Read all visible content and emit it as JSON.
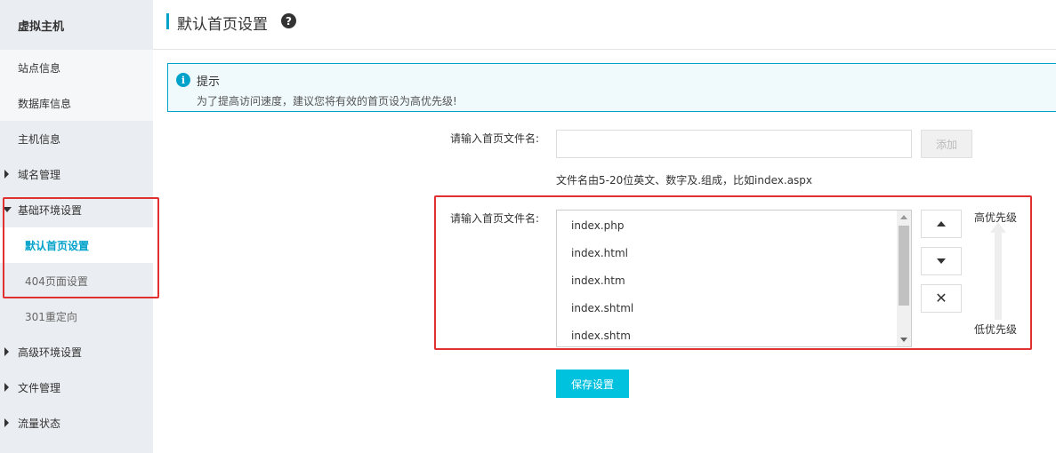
{
  "sidebar": {
    "title": "虚拟主机",
    "items": [
      {
        "label": "站点信息"
      },
      {
        "label": "数据库信息"
      },
      {
        "label": "主机信息"
      },
      {
        "label": "域名管理"
      },
      {
        "label": "基础环境设置"
      },
      {
        "label": "默认首页设置"
      },
      {
        "label": "404页面设置"
      },
      {
        "label": "301重定向"
      },
      {
        "label": "高级环境设置"
      },
      {
        "label": "文件管理"
      },
      {
        "label": "流量状态"
      }
    ]
  },
  "header": {
    "title": "默认首页设置",
    "help_glyph": "?"
  },
  "tip": {
    "icon_glyph": "i",
    "title": "提示",
    "text": "为了提高访问速度，建议您将有效的首页设为高优先级!"
  },
  "form": {
    "input_label": "请输入首页文件名:",
    "input_value": "",
    "add_button": "添加",
    "hint": "文件名由5-20位英文、数字及.组成，比如index.aspx",
    "list_label": "请输入首页文件名:",
    "files": [
      "index.php",
      "index.html",
      "index.htm",
      "index.shtml",
      "index.shtm"
    ],
    "high_priority": "高优先级",
    "low_priority": "低优先级",
    "remove_glyph": "✕",
    "save_button": "保存设置"
  },
  "colors": {
    "accent": "#00a2ca",
    "save_button": "#00c1de",
    "highlight_box": "#e03030"
  }
}
